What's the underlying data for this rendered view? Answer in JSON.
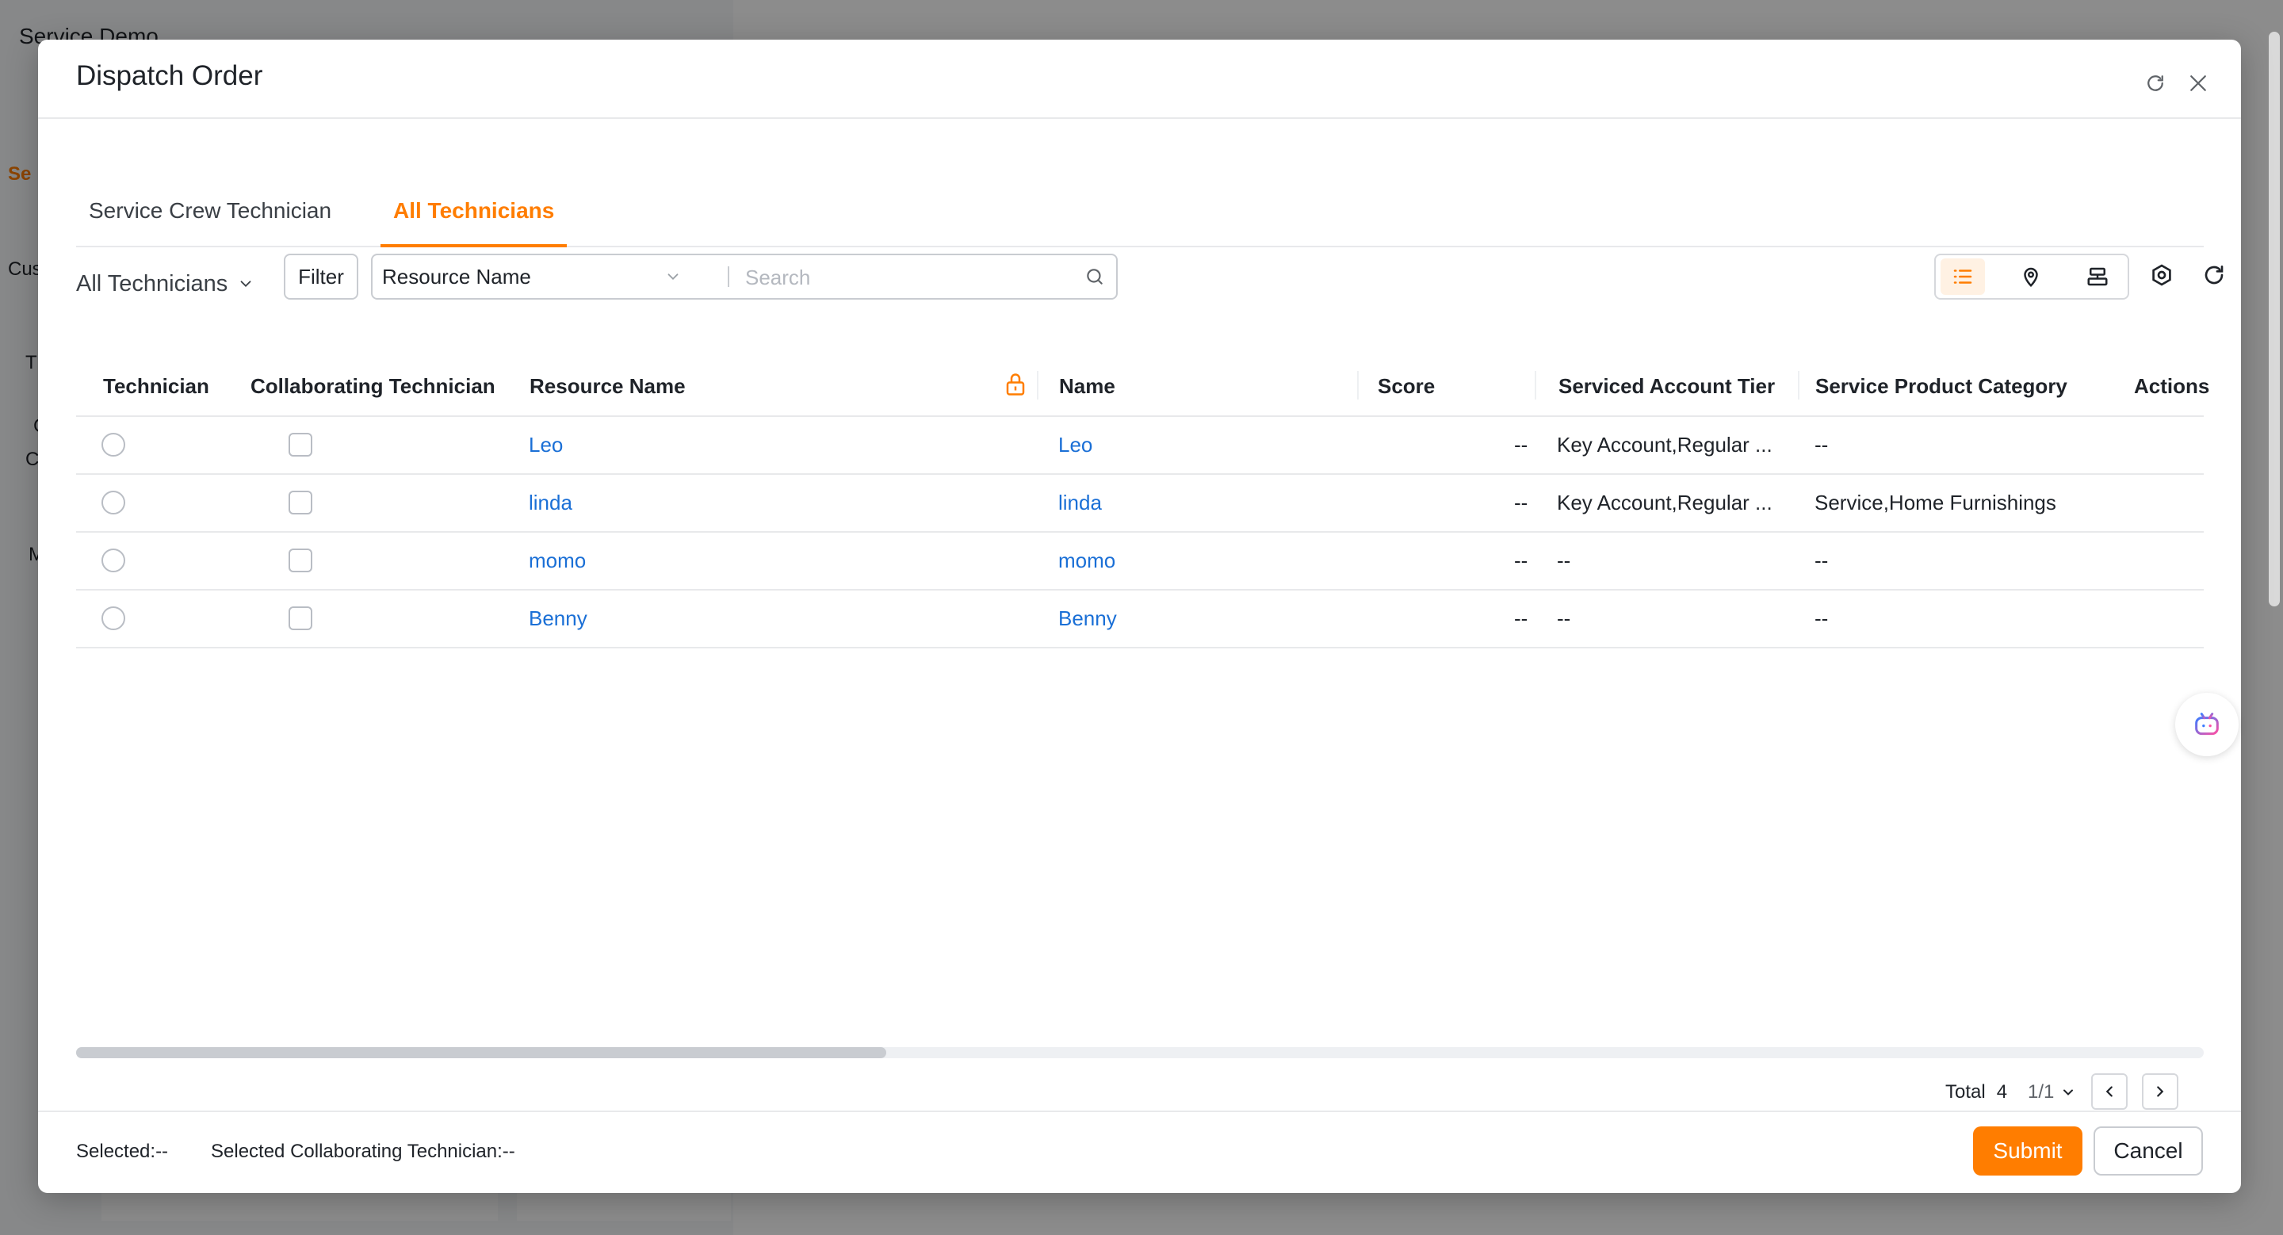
{
  "background": {
    "app_title": "Service Demo",
    "side_letters": [
      "Se",
      "Cus",
      "T",
      "C",
      "C",
      "M"
    ]
  },
  "modal": {
    "title": "Dispatch Order",
    "tabs": [
      {
        "label": "Service Crew Technician",
        "active": false
      },
      {
        "label": "All Technicians",
        "active": true
      }
    ],
    "toolbar": {
      "scope_label": "All Technicians",
      "filter_label": "Filter",
      "search_field": "Resource Name",
      "search_placeholder": "Search",
      "icons": [
        "list-view-icon",
        "map-view-icon",
        "gantt-view-icon",
        "settings-icon",
        "refresh-icon"
      ]
    },
    "table": {
      "columns": [
        "Technician",
        "Collaborating Technician",
        "Resource Name",
        "Name",
        "Score",
        "Serviced Account Tier",
        "Service Product Category",
        "Actions"
      ],
      "rows": [
        {
          "resource_name": "Leo",
          "name": "Leo",
          "score": "--",
          "tier": "Key Account,Regular ...",
          "category": "--"
        },
        {
          "resource_name": "linda",
          "name": "linda",
          "score": "--",
          "tier": "Key Account,Regular ...",
          "category": "Service,Home Furnishings"
        },
        {
          "resource_name": "momo",
          "name": "momo",
          "score": "--",
          "tier": "--",
          "category": "--"
        },
        {
          "resource_name": "Benny",
          "name": "Benny",
          "score": "--",
          "tier": "--",
          "category": "--"
        }
      ]
    },
    "pagination": {
      "total_label": "Total",
      "total": "4",
      "page": "1/1"
    },
    "footer": {
      "selected": "Selected:--",
      "selected_collab": "Selected Collaborating Technician:--",
      "submit_label": "Submit",
      "cancel_label": "Cancel"
    }
  },
  "colors": {
    "accent": "#ff7d00",
    "link": "#1a6fd6"
  }
}
